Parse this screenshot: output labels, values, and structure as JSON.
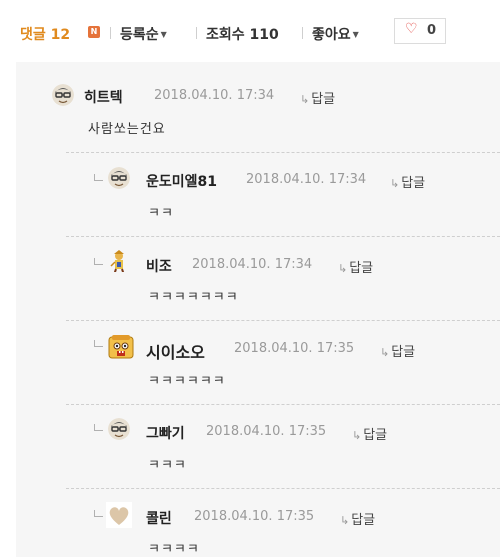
{
  "topbar": {
    "comments_label": "댓글",
    "comments_count": "12",
    "new_badge": "N",
    "sort_label": "등록순",
    "views_label": "조회수",
    "views_count": "110",
    "likes_label": "좋아요",
    "like_count": "0",
    "heart_icon": "heart-outline-icon",
    "accent_color": "#e08a1e"
  },
  "reply_label": "답글",
  "comments": [
    {
      "nick": "히트텍",
      "date": "2018.04.10. 17:34",
      "text": "사람쏘는건요",
      "avatar": "glasses-avatar-icon"
    },
    {
      "nick": "운도미엘81",
      "date": "2018.04.10. 17:34",
      "text": "ㅋㅋ",
      "avatar": "glasses-avatar-icon"
    },
    {
      "nick": "비조",
      "date": "2018.04.10. 17:34",
      "text": "ㅋㅋㅋㅋㅋㅋㅋ",
      "avatar": "character-avatar-icon"
    },
    {
      "nick": "시이소오",
      "date": "2018.04.10. 17:35",
      "text": "ㅋㅋㅋㅋㅋㅋ",
      "avatar": "box-face-avatar-icon"
    },
    {
      "nick": "그빠기",
      "date": "2018.04.10. 17:35",
      "text": "ㅋㅋㅋ",
      "avatar": "glasses-avatar-icon"
    },
    {
      "nick": "콜린",
      "date": "2018.04.10. 17:35",
      "text": "ㅋㅋㅋㅋ",
      "avatar": "heart-avatar-icon"
    }
  ]
}
